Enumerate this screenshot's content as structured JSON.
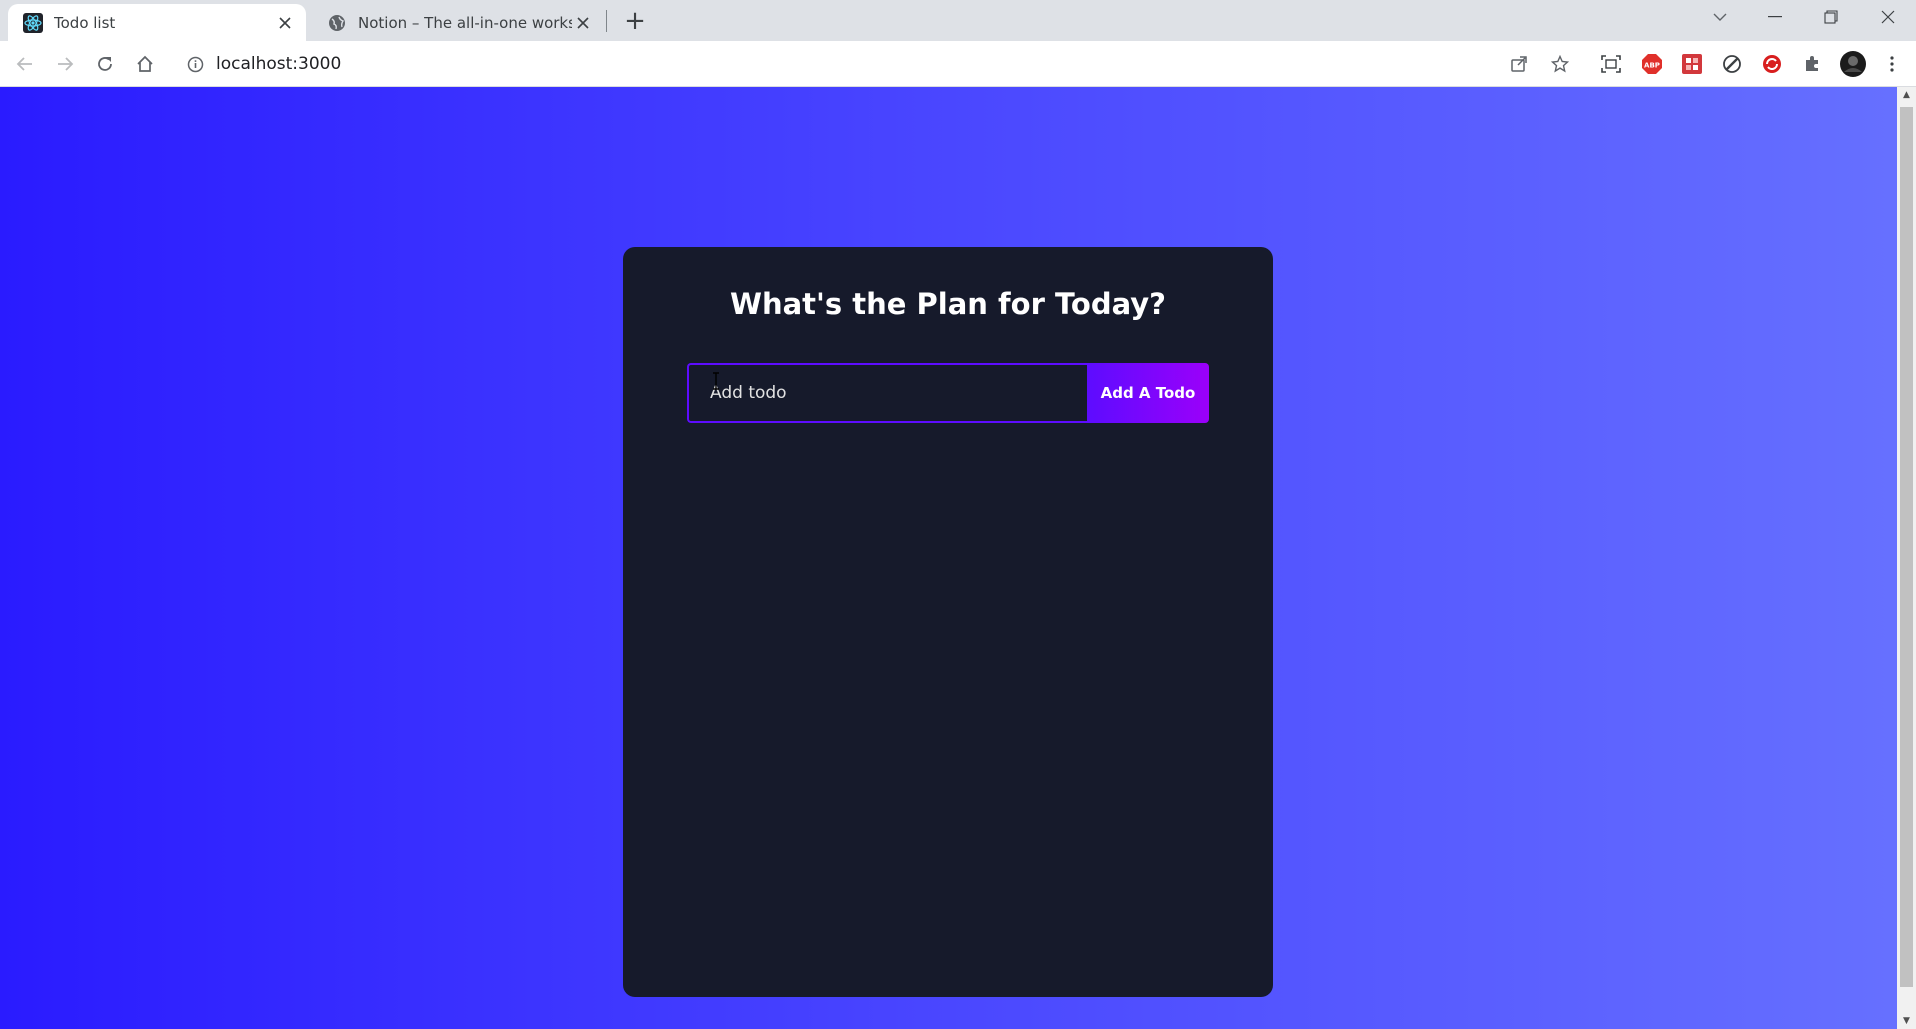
{
  "browser": {
    "tabs": [
      {
        "title": "Todo list",
        "favicon": "react-icon",
        "active": true
      },
      {
        "title": "Notion – The all-in-one workspac",
        "favicon": "globe-icon",
        "active": false
      }
    ],
    "new_tab_symbol": "+",
    "address": "localhost:3000",
    "colors": {
      "tabstrip": "#dee1e6",
      "toolbar": "#ffffff"
    }
  },
  "page": {
    "heading": "What's the Plan for Today?",
    "input_placeholder": "Add todo",
    "input_value": "",
    "button_label": "Add A Todo",
    "colors": {
      "background_start": "#2a1bff",
      "background_end": "#6670ff",
      "card": "#161a2b",
      "input_border": "#5d0cff",
      "button_start": "#5d0cff",
      "button_end": "#9b00fa"
    }
  }
}
